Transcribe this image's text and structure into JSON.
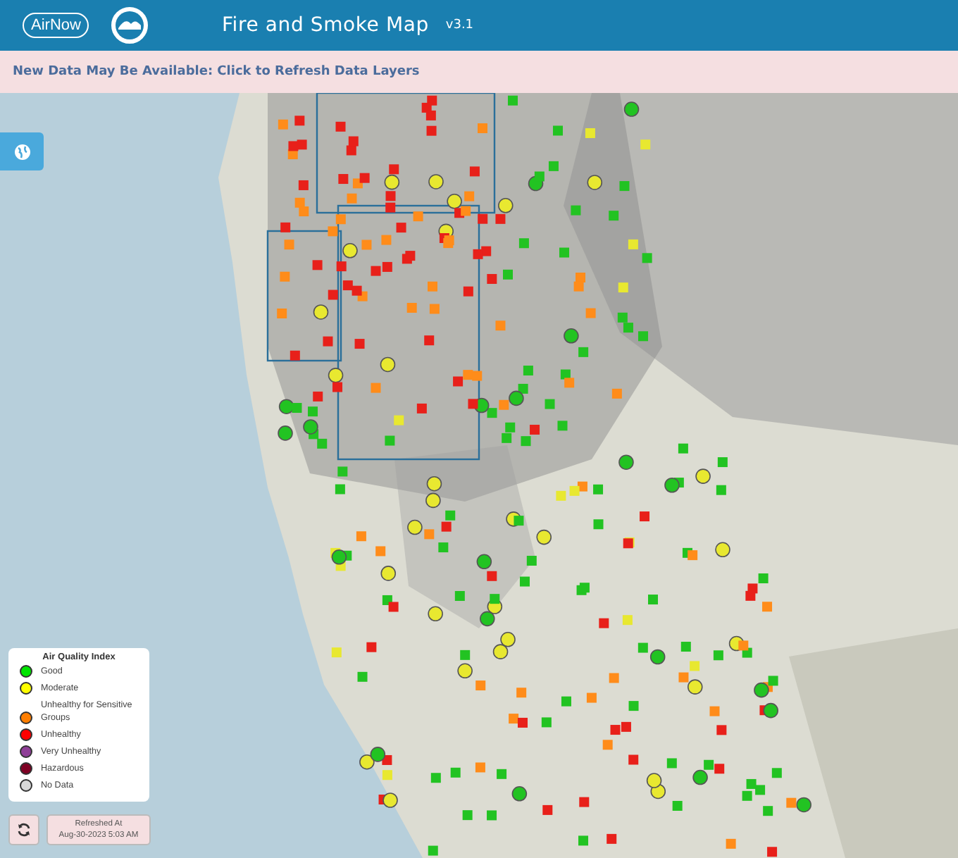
{
  "header": {
    "title": "Fire and Smoke Map",
    "version": "v3.1",
    "logo_text": "AirNow"
  },
  "banner": {
    "text": "New Data May Be Available: Click to Refresh Data Layers"
  },
  "legend": {
    "title": "Air Quality Index",
    "items": [
      {
        "label": "Good",
        "color": "#00e400"
      },
      {
        "label": "Moderate",
        "color": "#ffff00"
      },
      {
        "label": "Unhealthy for Sensitive Groups",
        "color": "#ff7e00"
      },
      {
        "label": "Unhealthy",
        "color": "#ff0000"
      },
      {
        "label": "Very Unhealthy",
        "color": "#8f3f97"
      },
      {
        "label": "Hazardous",
        "color": "#7e0023"
      },
      {
        "label": "No Data",
        "color": "#d9d9d9"
      }
    ]
  },
  "refresh": {
    "label_line_1": "Refreshed At",
    "label_line_2": "Aug-30-2023 5:03 AM"
  }
}
